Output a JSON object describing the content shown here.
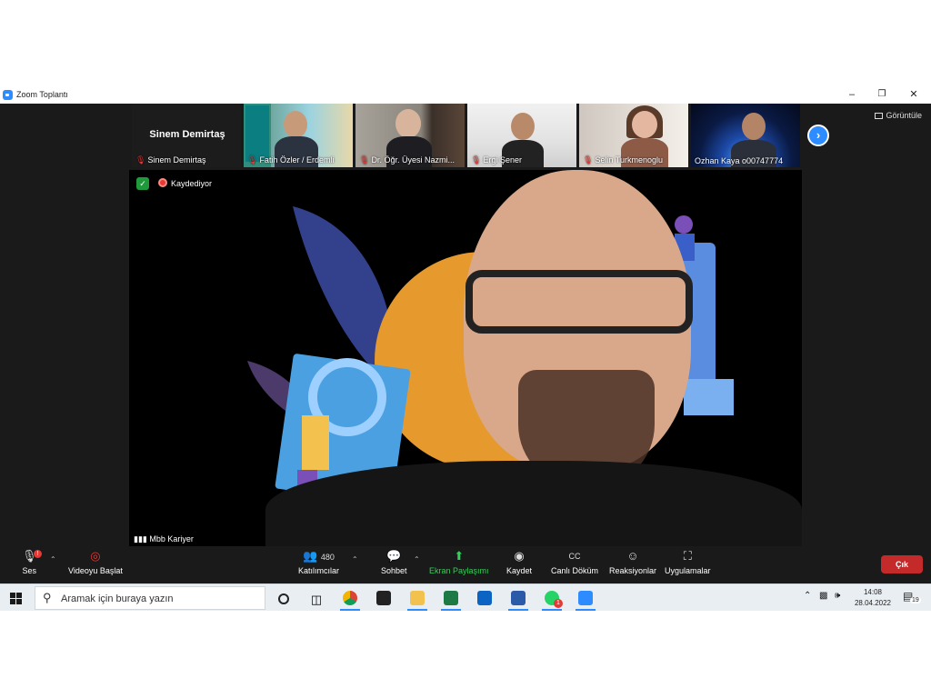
{
  "window": {
    "title": "Zoom Toplantı"
  },
  "top_right": {
    "view_label": "Görüntüle"
  },
  "participants": [
    {
      "name": "Sinem Demirtaş",
      "display": "Sinem Demirtaş",
      "muted": true
    },
    {
      "name": "Fatih Özler / Erdemli",
      "muted": true
    },
    {
      "name": "Dr. Öğr. Üyesi Nazmi...",
      "muted": true
    },
    {
      "name": "Ergi Şener",
      "muted": true
    },
    {
      "name": "Selin Turkmenoglu",
      "muted": true
    },
    {
      "name": "Ozhan Kaya o00747774",
      "muted": false
    }
  ],
  "speaker": {
    "name": "Mbb Kariyer",
    "recording_label": "Kaydediyor"
  },
  "toolbar": {
    "audio": "Ses",
    "video": "Videoyu Başlat",
    "participants": "Katılımcılar",
    "participants_count": "480",
    "chat": "Sohbet",
    "share": "Ekran Paylaşımı",
    "record": "Kaydet",
    "captions": "Canlı Döküm",
    "reactions": "Reaksiyonlar",
    "apps": "Uygulamalar",
    "leave": "Çık",
    "audio_badge": "!"
  },
  "taskbar": {
    "search_placeholder": "Aramak için buraya yazın",
    "time": "14:08",
    "date": "28.04.2022",
    "notif_count": "19",
    "whatsapp_badge": "1"
  },
  "colors": {
    "accent": "#2d8cff",
    "leave": "#c52a2a",
    "share_green": "#32d158",
    "mute_red": "#e53935"
  }
}
